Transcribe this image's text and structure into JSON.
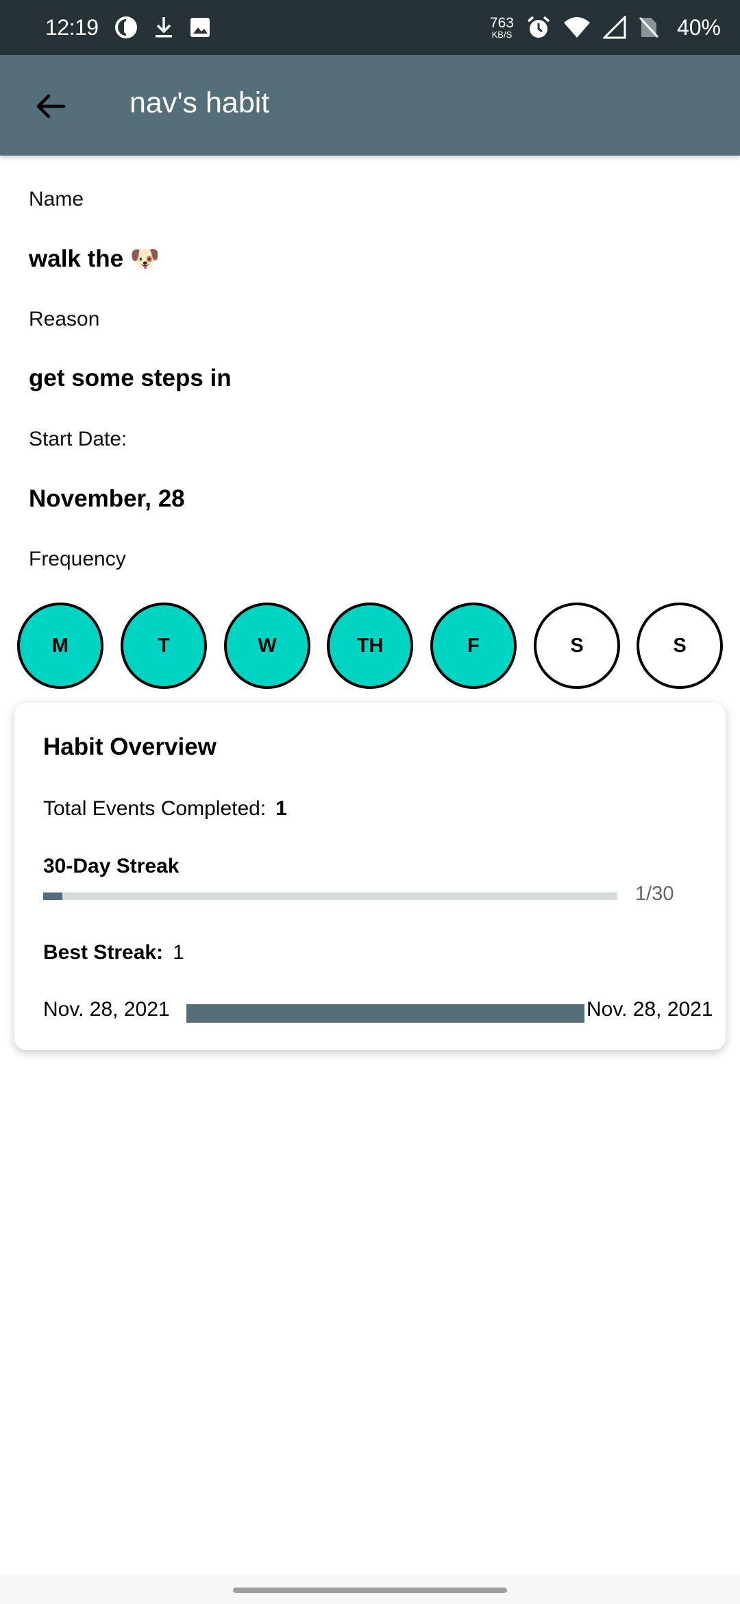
{
  "status_bar": {
    "time": "12:19",
    "net_speed_value": "763",
    "net_speed_unit": "KB/S",
    "battery": "40%",
    "icons": [
      "app-icon",
      "download-icon",
      "image-icon",
      "alarm-icon",
      "wifi-icon",
      "signal-icon",
      "no-sim-icon"
    ]
  },
  "app_bar": {
    "title": "nav's habit",
    "back_icon": "arrow-back-icon"
  },
  "habit": {
    "name_label": "Name",
    "name_value": "walk the 🐶",
    "reason_label": "Reason",
    "reason_value": "get some steps in",
    "start_label": "Start Date:",
    "start_value": "November, 28",
    "frequency_label": "Frequency",
    "days": [
      {
        "label": "M",
        "selected": true
      },
      {
        "label": "T",
        "selected": true
      },
      {
        "label": "W",
        "selected": true
      },
      {
        "label": "TH",
        "selected": true
      },
      {
        "label": "F",
        "selected": true
      },
      {
        "label": "S",
        "selected": false
      },
      {
        "label": "S",
        "selected": false
      }
    ]
  },
  "overview": {
    "title": "Habit Overview",
    "total_label": "Total Events Completed:",
    "total_value": "1",
    "streak_title": "30-Day Streak",
    "streak_progress": 0.0333,
    "streak_count": "1/30",
    "best_label": "Best Streak:",
    "best_value": "1",
    "range_start": "Nov. 28, 2021",
    "range_end": "Nov. 28, 2021"
  },
  "colors": {
    "status_bar": "#263238",
    "app_bar": "#546e7a",
    "day_selected": "#00d4c2",
    "accent_bar": "#546e7a",
    "track": "#d5dadd"
  }
}
